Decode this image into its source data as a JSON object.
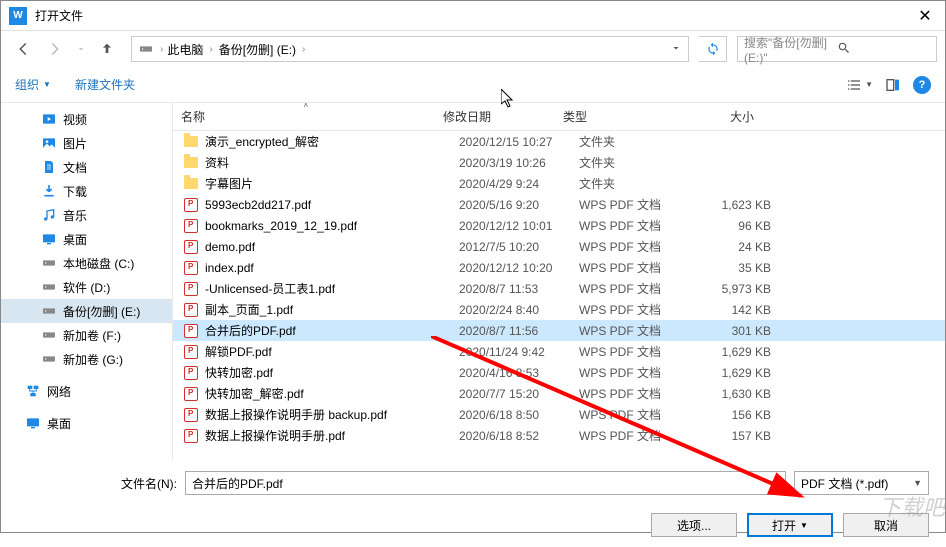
{
  "window": {
    "title": "打开文件"
  },
  "nav": {
    "breadcrumb": [
      "此电脑",
      "备份[勿删] (E:)"
    ],
    "search_placeholder": "搜索\"备份[勿删] (E:)\""
  },
  "toolbar": {
    "organize": "组织",
    "new_folder": "新建文件夹"
  },
  "sidebar": [
    {
      "label": "视频",
      "icon": "video",
      "indent": 2
    },
    {
      "label": "图片",
      "icon": "pictures",
      "indent": 2
    },
    {
      "label": "文档",
      "icon": "documents",
      "indent": 2
    },
    {
      "label": "下载",
      "icon": "downloads",
      "indent": 2
    },
    {
      "label": "音乐",
      "icon": "music",
      "indent": 2
    },
    {
      "label": "桌面",
      "icon": "desktop",
      "indent": 2
    },
    {
      "label": "本地磁盘 (C:)",
      "icon": "drive",
      "indent": 2
    },
    {
      "label": "软件 (D:)",
      "icon": "drive",
      "indent": 2
    },
    {
      "label": "备份[勿删] (E:)",
      "icon": "drive",
      "indent": 2,
      "selected": true
    },
    {
      "label": "新加卷 (F:)",
      "icon": "drive",
      "indent": 2
    },
    {
      "label": "新加卷 (G:)",
      "icon": "drive",
      "indent": 2
    },
    {
      "spacer": true
    },
    {
      "label": "网络",
      "icon": "network",
      "indent": 1
    },
    {
      "spacer": true
    },
    {
      "label": "桌面",
      "icon": "desktop2",
      "indent": 1
    }
  ],
  "columns": {
    "name": "名称",
    "date": "修改日期",
    "type": "类型",
    "size": "大小"
  },
  "files": [
    {
      "name": "演示_encrypted_解密",
      "date": "2020/12/15 10:27",
      "type": "文件夹",
      "size": "",
      "kind": "folder"
    },
    {
      "name": "资料",
      "date": "2020/3/19 10:26",
      "type": "文件夹",
      "size": "",
      "kind": "folder"
    },
    {
      "name": "字幕图片",
      "date": "2020/4/29 9:24",
      "type": "文件夹",
      "size": "",
      "kind": "folder"
    },
    {
      "name": "5993ecb2dd217.pdf",
      "date": "2020/5/16 9:20",
      "type": "WPS PDF 文档",
      "size": "1,623 KB",
      "kind": "pdf"
    },
    {
      "name": "bookmarks_2019_12_19.pdf",
      "date": "2020/12/12 10:01",
      "type": "WPS PDF 文档",
      "size": "96 KB",
      "kind": "pdf"
    },
    {
      "name": "demo.pdf",
      "date": "2012/7/5 10:20",
      "type": "WPS PDF 文档",
      "size": "24 KB",
      "kind": "pdf"
    },
    {
      "name": "index.pdf",
      "date": "2020/12/12 10:20",
      "type": "WPS PDF 文档",
      "size": "35 KB",
      "kind": "pdf"
    },
    {
      "name": "-Unlicensed-员工表1.pdf",
      "date": "2020/8/7 11:53",
      "type": "WPS PDF 文档",
      "size": "5,973 KB",
      "kind": "pdf"
    },
    {
      "name": "副本_页面_1.pdf",
      "date": "2020/2/24 8:40",
      "type": "WPS PDF 文档",
      "size": "142 KB",
      "kind": "pdf"
    },
    {
      "name": "合并后的PDF.pdf",
      "date": "2020/8/7 11:56",
      "type": "WPS PDF 文档",
      "size": "301 KB",
      "kind": "pdf",
      "selected": true
    },
    {
      "name": "解锁PDF.pdf",
      "date": "2020/11/24 9:42",
      "type": "WPS PDF 文档",
      "size": "1,629 KB",
      "kind": "pdf"
    },
    {
      "name": "快转加密.pdf",
      "date": "2020/4/16 8:53",
      "type": "WPS PDF 文档",
      "size": "1,629 KB",
      "kind": "pdf"
    },
    {
      "name": "快转加密_解密.pdf",
      "date": "2020/7/7 15:20",
      "type": "WPS PDF 文档",
      "size": "1,630 KB",
      "kind": "pdf"
    },
    {
      "name": "数据上报操作说明手册 backup.pdf",
      "date": "2020/6/18 8:50",
      "type": "WPS PDF 文档",
      "size": "156 KB",
      "kind": "pdf"
    },
    {
      "name": "数据上报操作说明手册.pdf",
      "date": "2020/6/18 8:52",
      "type": "WPS PDF 文档",
      "size": "157 KB",
      "kind": "pdf"
    }
  ],
  "footer": {
    "filename_label": "文件名(N):",
    "filename_value": "合并后的PDF.pdf",
    "filter": "PDF 文档 (*.pdf)",
    "options": "选项...",
    "open": "打开",
    "cancel": "取消"
  },
  "watermark": "下载吧"
}
